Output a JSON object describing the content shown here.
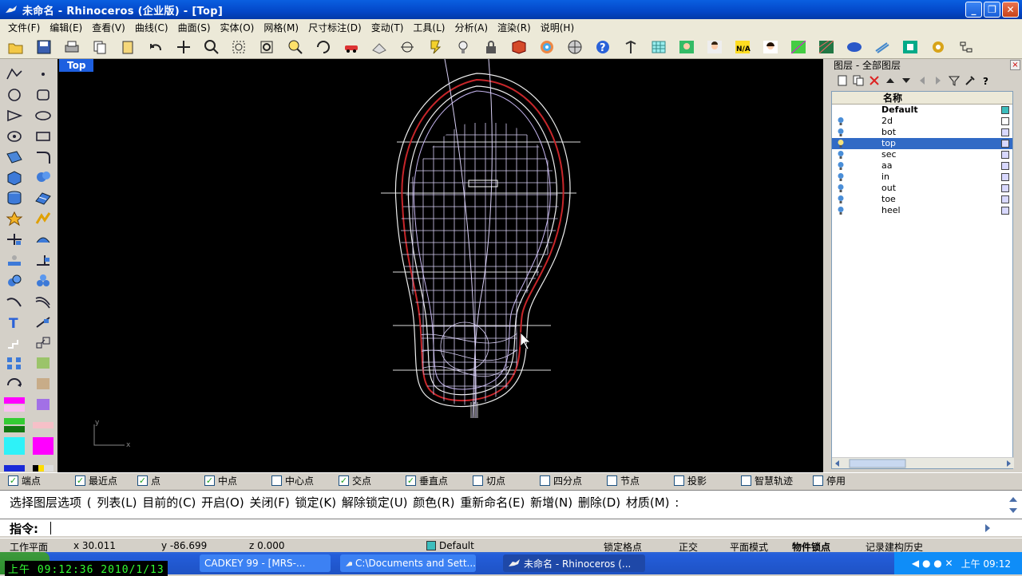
{
  "window": {
    "title": "未命名 - Rhinoceros (企业版) - [Top]"
  },
  "menu": [
    "文件(F)",
    "编辑(E)",
    "查看(V)",
    "曲线(C)",
    "曲面(S)",
    "实体(O)",
    "网格(M)",
    "尺寸标注(D)",
    "变动(T)",
    "工具(L)",
    "分析(A)",
    "渲染(R)",
    "说明(H)"
  ],
  "toolbar_icons": [
    "new-file-icon",
    "open-file-icon",
    "save-icon",
    "print-icon",
    "copy-icon",
    "paste-icon",
    "undo-icon",
    "pan-icon",
    "zoom-window-icon",
    "zoom-extents-icon",
    "zoom-selected-icon",
    "zoom-dynamic-icon",
    "rotate-view-icon",
    "car-icon",
    "grid-icon",
    "osnap-icon",
    "layer-bulb-icon",
    "lock-icon",
    "material-icon",
    "color-wheel-icon",
    "sphere-icon",
    "help-icon",
    "tools-icon",
    "mesh-icon",
    "avatar-icon",
    "avatar-icon-2",
    "na-icon",
    "avatar-icon-3",
    "flag-icon",
    "flag-icon-2",
    "globe-icon",
    "stripes-icon",
    "green-square-icon",
    "gear-icon",
    "network-icon"
  ],
  "viewport": {
    "label": "Top"
  },
  "layers": {
    "title": "图层 - 全部图层",
    "column_header": "名称",
    "items": [
      {
        "name": "Default",
        "color": "#3cbdbd",
        "default": true
      },
      {
        "name": "2d",
        "color": "#ffffff"
      },
      {
        "name": "bot",
        "color": "#d8d8ff"
      },
      {
        "name": "top",
        "color": "#d8d8ff",
        "selected": true
      },
      {
        "name": "sec",
        "color": "#d8d8ff"
      },
      {
        "name": "aa",
        "color": "#d8d8ff"
      },
      {
        "name": "in",
        "color": "#d8d8ff"
      },
      {
        "name": "out",
        "color": "#d8d8ff"
      },
      {
        "name": "toe",
        "color": "#d8d8ff"
      },
      {
        "name": "heel",
        "color": "#d8d8ff"
      }
    ]
  },
  "osnap": [
    {
      "label": "端点",
      "checked": true
    },
    {
      "label": "最近点",
      "checked": true
    },
    {
      "label": "点",
      "checked": true
    },
    {
      "label": "中点",
      "checked": true
    },
    {
      "label": "中心点",
      "checked": false
    },
    {
      "label": "交点",
      "checked": true
    },
    {
      "label": "垂直点",
      "checked": true
    },
    {
      "label": "切点",
      "checked": false
    },
    {
      "label": "四分点",
      "checked": false
    },
    {
      "label": "节点",
      "checked": false
    },
    {
      "label": "投影",
      "checked": false
    },
    {
      "label": "智慧轨迹",
      "checked": false
    },
    {
      "label": "停用",
      "checked": false
    }
  ],
  "command": {
    "history": "选择图层选项 ( 列表(L) 目前的(C) 开启(O) 关闭(F) 锁定(K) 解除锁定(U) 颜色(R) 重新命名(E) 新增(N) 删除(D) 材质(M) :",
    "prompt": "指令:"
  },
  "status": {
    "cplane": "工作平面",
    "x": "x 30.011",
    "y": "y -86.699",
    "z": "z 0.000",
    "layer": "Default",
    "grid_snap": "锁定格点",
    "ortho": "正交",
    "planar": "平面模式",
    "osnap": "物件锁点",
    "history": "记录建构历史"
  },
  "taskbar": {
    "clock_overlay": "上午 09:12:36 2010/1/13",
    "tasks": [
      "CADKEY 99 - [MRS-...",
      "C:\\Documents and Sett...",
      "未命名 - Rhinoceros (..."
    ],
    "tray_time": "上午 09:12"
  }
}
